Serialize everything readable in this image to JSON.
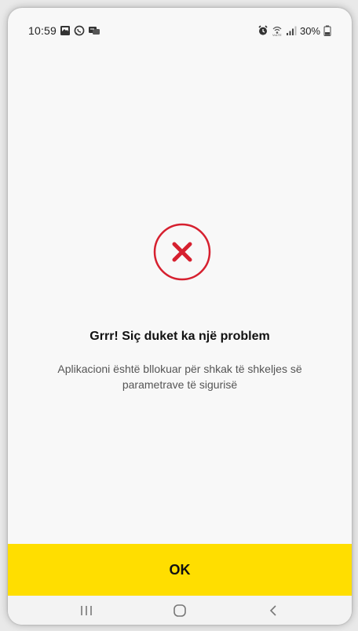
{
  "status_bar": {
    "time": "10:59",
    "battery": "30%",
    "left_icons": [
      "gallery-icon",
      "whatsapp-icon",
      "message-icon"
    ],
    "right_icons": [
      "alarm-icon",
      "wifi-calling-icon",
      "signal-icon",
      "battery-icon"
    ]
  },
  "dialog": {
    "icon": "error-x-icon",
    "title": "Grrr! Siç duket ka një problem",
    "message": "Aplikacioni është bllokuar për shkak të shkeljes së parametrave të sigurisë"
  },
  "ok_button": {
    "label": "OK"
  },
  "nav_bar": {
    "buttons": [
      "recent-apps-icon",
      "home-icon",
      "back-icon"
    ]
  },
  "colors": {
    "accent_yellow": "#ffde00",
    "error_red": "#d6202f",
    "background": "#f8f8f8"
  }
}
